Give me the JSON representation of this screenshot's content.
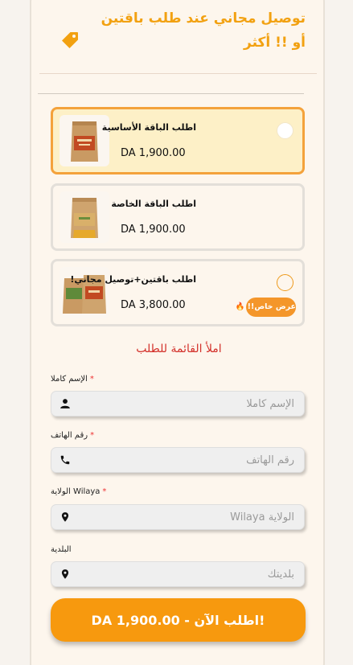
{
  "banner": {
    "text": "توصيل مجاني عند طلب باقتين أو !! أكثر"
  },
  "packages": [
    {
      "title": "اطلب الباقة الأساسية",
      "price": "DA 1,900.00",
      "selected": true
    },
    {
      "title": "اطلب الباقة الخاصة",
      "price": "DA 1,900.00",
      "selected": false
    },
    {
      "title": "اطلب باقتين+توصيل مجاني!",
      "price": "DA 3,800.00",
      "selected": false,
      "badge": "عرض خاص!! 🔥"
    }
  ],
  "form": {
    "title": "املأ القائمة للطلب",
    "fields": [
      {
        "label": "الإسم كاملا",
        "required": true,
        "placeholder": "الإسم كاملا",
        "icon": "person-icon"
      },
      {
        "label": "رقم الهاتف",
        "required": true,
        "placeholder": "رقم الهاتف",
        "icon": "phone-icon"
      },
      {
        "label": "الولاية Wilaya",
        "required": true,
        "placeholder": "الولاية Wilaya",
        "icon": "location-pin-icon"
      },
      {
        "label": "البلدية",
        "required": false,
        "placeholder": "بلديتك",
        "icon": "location-pin-icon"
      }
    ],
    "submit_label": "DA 1,900.00 - اطلب الآن!"
  },
  "colors": {
    "accent": "#f7990e",
    "banner_text": "#f2a111",
    "selected_bg": "#fdf0c7",
    "selected_border": "#f4a23b",
    "form_title": "#d3302a"
  }
}
